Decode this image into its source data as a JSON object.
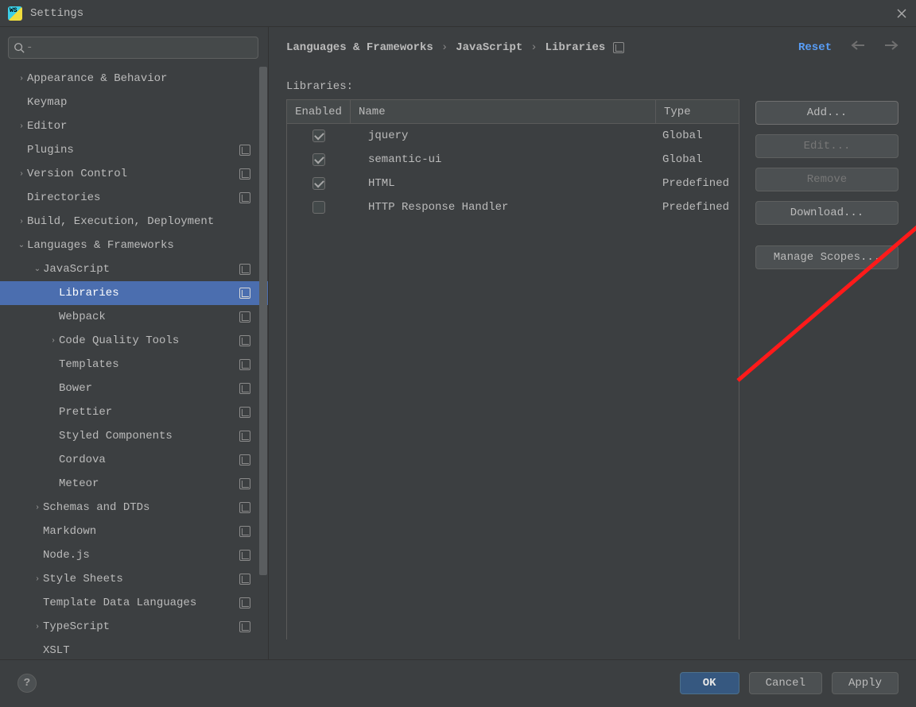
{
  "window": {
    "title": "Settings"
  },
  "search": {
    "placeholder": ""
  },
  "sidebar": {
    "items": [
      {
        "label": "Appearance & Behavior",
        "indent": 0,
        "chevron": "right",
        "badge": false,
        "selected": false
      },
      {
        "label": "Keymap",
        "indent": 0,
        "chevron": "",
        "badge": false,
        "selected": false
      },
      {
        "label": "Editor",
        "indent": 0,
        "chevron": "right",
        "badge": false,
        "selected": false
      },
      {
        "label": "Plugins",
        "indent": 0,
        "chevron": "",
        "badge": true,
        "selected": false
      },
      {
        "label": "Version Control",
        "indent": 0,
        "chevron": "right",
        "badge": true,
        "selected": false
      },
      {
        "label": "Directories",
        "indent": 0,
        "chevron": "",
        "badge": true,
        "selected": false
      },
      {
        "label": "Build, Execution, Deployment",
        "indent": 0,
        "chevron": "right",
        "badge": false,
        "selected": false
      },
      {
        "label": "Languages & Frameworks",
        "indent": 0,
        "chevron": "down",
        "badge": false,
        "selected": false
      },
      {
        "label": "JavaScript",
        "indent": 1,
        "chevron": "down",
        "badge": true,
        "selected": false
      },
      {
        "label": "Libraries",
        "indent": 2,
        "chevron": "",
        "badge": true,
        "selected": true
      },
      {
        "label": "Webpack",
        "indent": 2,
        "chevron": "",
        "badge": true,
        "selected": false
      },
      {
        "label": "Code Quality Tools",
        "indent": 2,
        "chevron": "right",
        "badge": true,
        "selected": false
      },
      {
        "label": "Templates",
        "indent": 2,
        "chevron": "",
        "badge": true,
        "selected": false
      },
      {
        "label": "Bower",
        "indent": 2,
        "chevron": "",
        "badge": true,
        "selected": false
      },
      {
        "label": "Prettier",
        "indent": 2,
        "chevron": "",
        "badge": true,
        "selected": false
      },
      {
        "label": "Styled Components",
        "indent": 2,
        "chevron": "",
        "badge": true,
        "selected": false
      },
      {
        "label": "Cordova",
        "indent": 2,
        "chevron": "",
        "badge": true,
        "selected": false
      },
      {
        "label": "Meteor",
        "indent": 2,
        "chevron": "",
        "badge": true,
        "selected": false
      },
      {
        "label": "Schemas and DTDs",
        "indent": 1,
        "chevron": "right",
        "badge": true,
        "selected": false
      },
      {
        "label": "Markdown",
        "indent": 1,
        "chevron": "",
        "badge": true,
        "selected": false
      },
      {
        "label": "Node.js",
        "indent": 1,
        "chevron": "",
        "badge": true,
        "selected": false
      },
      {
        "label": "Style Sheets",
        "indent": 1,
        "chevron": "right",
        "badge": true,
        "selected": false
      },
      {
        "label": "Template Data Languages",
        "indent": 1,
        "chevron": "",
        "badge": true,
        "selected": false
      },
      {
        "label": "TypeScript",
        "indent": 1,
        "chevron": "right",
        "badge": true,
        "selected": false
      },
      {
        "label": "XSLT",
        "indent": 1,
        "chevron": "",
        "badge": false,
        "selected": false
      }
    ]
  },
  "breadcrumb": {
    "a": "Languages & Frameworks",
    "b": "JavaScript",
    "c": "Libraries",
    "reset": "Reset"
  },
  "table": {
    "label": "Libraries:",
    "headers": {
      "enabled": "Enabled",
      "name": "Name",
      "type": "Type"
    },
    "rows": [
      {
        "enabled": true,
        "name": "jquery",
        "type": "Global"
      },
      {
        "enabled": true,
        "name": "semantic-ui",
        "type": "Global"
      },
      {
        "enabled": true,
        "name": "HTML",
        "type": "Predefined"
      },
      {
        "enabled": false,
        "name": "HTTP Response Handler",
        "type": "Predefined"
      }
    ]
  },
  "buttons": {
    "add": "Add...",
    "edit": "Edit...",
    "remove": "Remove",
    "download": "Download...",
    "scopes": "Manage Scopes..."
  },
  "footer": {
    "help": "?",
    "ok": "OK",
    "cancel": "Cancel",
    "apply": "Apply"
  }
}
